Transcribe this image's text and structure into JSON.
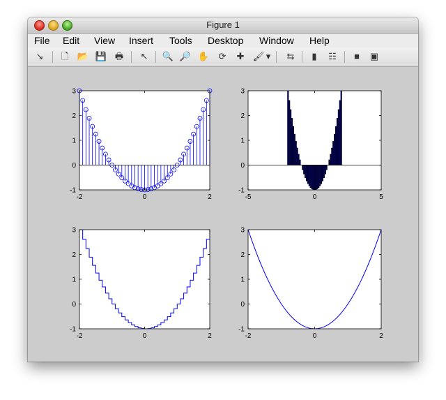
{
  "window": {
    "title": "Figure 1"
  },
  "menubar": {
    "items": [
      "File",
      "Edit",
      "View",
      "Insert",
      "Tools",
      "Desktop",
      "Window",
      "Help"
    ]
  },
  "toolbar": {
    "tools": [
      {
        "name": "dock-arrow-icon",
        "glyph": "↘"
      },
      {
        "name": "new-figure-icon",
        "glyph": "🗋"
      },
      {
        "name": "open-file-icon",
        "glyph": "📂"
      },
      {
        "name": "save-icon",
        "glyph": "💾"
      },
      {
        "name": "print-icon",
        "glyph": "🖶"
      },
      {
        "name": "pointer-icon",
        "glyph": "↖"
      },
      {
        "name": "zoom-in-icon",
        "glyph": "🔍"
      },
      {
        "name": "zoom-out-icon",
        "glyph": "🔎"
      },
      {
        "name": "pan-hand-icon",
        "glyph": "✋"
      },
      {
        "name": "rotate-3d-icon",
        "glyph": "⟳"
      },
      {
        "name": "data-cursor-icon",
        "glyph": "✚"
      },
      {
        "name": "brush-icon",
        "glyph": "🖌"
      },
      {
        "name": "dropdown-arrow-icon",
        "glyph": "▾"
      },
      {
        "name": "link-plot-icon",
        "glyph": "⇆"
      },
      {
        "name": "colorbar-icon",
        "glyph": "▮"
      },
      {
        "name": "legend-icon",
        "glyph": "☷"
      },
      {
        "name": "hide-plot-tools-icon",
        "glyph": "■"
      },
      {
        "name": "show-plot-tools-icon",
        "glyph": "▣"
      }
    ]
  },
  "chart_data": [
    {
      "type": "scatter",
      "style": "stem",
      "function": "y = x^2 - 1",
      "x_start": -2,
      "x_end": 2,
      "n_points": 41,
      "xlim": [
        -2,
        2
      ],
      "ylim": [
        -1,
        3
      ],
      "xticks": [
        "-2",
        "0",
        "2"
      ],
      "yticks": [
        "-1",
        "0",
        "1",
        "2",
        "3"
      ],
      "color": "#0000ff"
    },
    {
      "type": "bar",
      "function": "y = x^2 - 1",
      "x_start": -2,
      "x_end": 2,
      "n_points": 41,
      "xlim": [
        -5,
        5
      ],
      "ylim": [
        -1,
        3
      ],
      "xticks": [
        "-5",
        "0",
        "5"
      ],
      "yticks": [
        "-1",
        "0",
        "1",
        "2",
        "3"
      ],
      "color": "#00007f"
    },
    {
      "type": "line",
      "style": "stairs",
      "function": "y = x^2 - 1",
      "x_start": -2,
      "x_end": 2,
      "n_points": 41,
      "xlim": [
        -2,
        2
      ],
      "ylim": [
        -1,
        3
      ],
      "xticks": [
        "-2",
        "0",
        "2"
      ],
      "yticks": [
        "-1",
        "0",
        "1",
        "2",
        "3"
      ],
      "color": "#0000ff"
    },
    {
      "type": "line",
      "function": "y = x^2 - 1",
      "x_start": -2,
      "x_end": 2,
      "n_points": 41,
      "xlim": [
        -2,
        2
      ],
      "ylim": [
        -1,
        3
      ],
      "xticks": [
        "-2",
        "0",
        "2"
      ],
      "yticks": [
        "-1",
        "0",
        "1",
        "2",
        "3"
      ],
      "color": "#0000ff"
    }
  ]
}
